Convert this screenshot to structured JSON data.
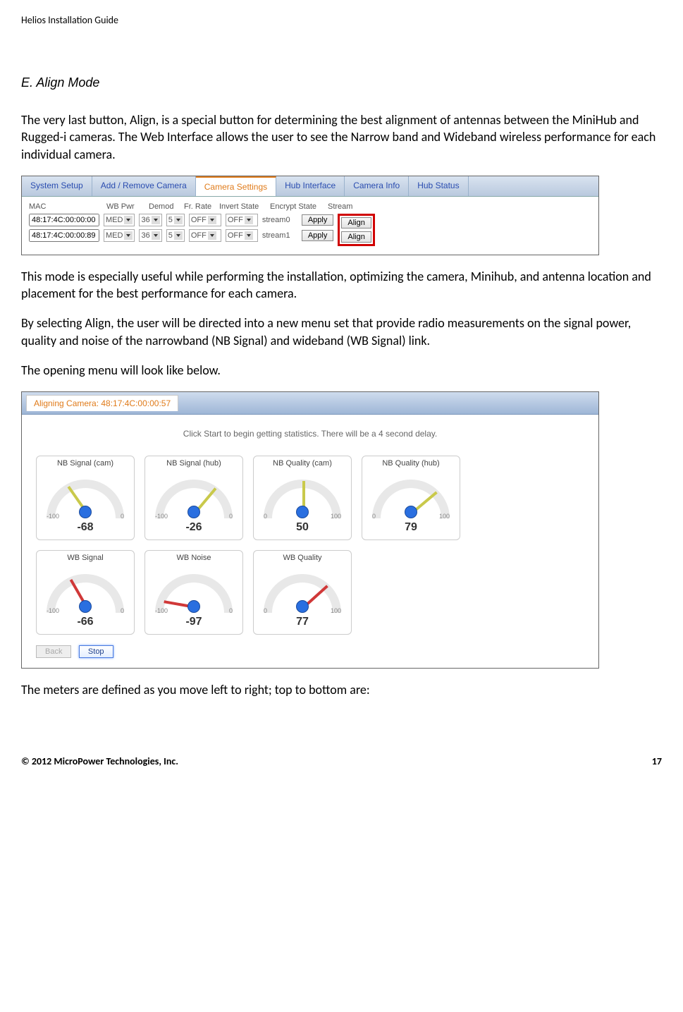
{
  "header": "Helios Installation Guide",
  "section_title": "E. Align Mode",
  "para1": "The very last button, Align, is a special button for determining the best alignment of antennas between the MiniHub and Rugged-i cameras.  The Web Interface allows the user to see the Narrow band and Wideband wireless performance for each individual camera.",
  "shot1": {
    "tabs": [
      "System Setup",
      "Add / Remove Camera",
      "Camera Settings",
      "Hub Interface",
      "Camera Info",
      "Hub Status"
    ],
    "cols": {
      "mac": "MAC",
      "wb": "WB Pwr",
      "demod": "Demod",
      "fr": "Fr. Rate",
      "invert": "Invert State",
      "encrypt": "Encrypt State",
      "stream": "Stream"
    },
    "rows": [
      {
        "mac": "48:17:4C:00:00:00",
        "wb": "MED",
        "demod": "36",
        "fr": "5",
        "invert": "OFF",
        "encrypt": "OFF",
        "stream": "stream0",
        "apply": "Apply",
        "align": "Align"
      },
      {
        "mac": "48:17:4C:00:00:89",
        "wb": "MED",
        "demod": "36",
        "fr": "5",
        "invert": "OFF",
        "encrypt": "OFF",
        "stream": "stream1",
        "apply": "Apply",
        "align": "Align"
      }
    ]
  },
  "para2": "This mode is especially useful while performing the installation, optimizing the camera, Minihub, and antenna location and placement for the best performance for each camera.",
  "para3": "By selecting Align, the user will be directed into a new menu set that provide radio measurements on the signal power, quality and noise of the narrowband (NB Signal) and wideband (WB Signal) link.",
  "para4": "The opening menu will look like below.",
  "shot2": {
    "title": "Aligning Camera: 48:17:4C:00:00:57",
    "hint": "Click Start to begin getting statistics. There will be a 4 second delay.",
    "gauges_top": [
      {
        "title": "NB Signal (cam)",
        "tick_l": "-100",
        "tick_r": "0",
        "value": "-68",
        "angle": -35,
        "cls": "needle-yellow"
      },
      {
        "title": "NB Signal (hub)",
        "tick_l": "-100",
        "tick_r": "0",
        "value": "-26",
        "angle": 40,
        "cls": "needle-yellow"
      },
      {
        "title": "NB Quality (cam)",
        "tick_l": "0",
        "tick_r": "100",
        "value": "50",
        "angle": 0,
        "cls": "needle-yellow"
      },
      {
        "title": "NB Quality (hub)",
        "tick_l": "0",
        "tick_r": "100",
        "value": "79",
        "angle": 50,
        "cls": "needle-yellow"
      }
    ],
    "gauges_bot": [
      {
        "title": "WB Signal",
        "tick_l": "-100",
        "tick_r": "0",
        "value": "-66",
        "angle": -30,
        "cls": "needle-red"
      },
      {
        "title": "WB Noise",
        "tick_l": "-100",
        "tick_r": "0",
        "value": "-97",
        "angle": -80,
        "cls": "needle-red"
      },
      {
        "title": "WB Quality",
        "tick_l": "0",
        "tick_r": "100",
        "value": "77",
        "angle": 48,
        "cls": "needle-red"
      }
    ],
    "back": "Back",
    "stop": "Stop"
  },
  "para5": "The meters are defined as you move left to right; top to bottom are:",
  "footer_left": "© 2012 MicroPower Technologies, Inc.",
  "footer_right": "17"
}
